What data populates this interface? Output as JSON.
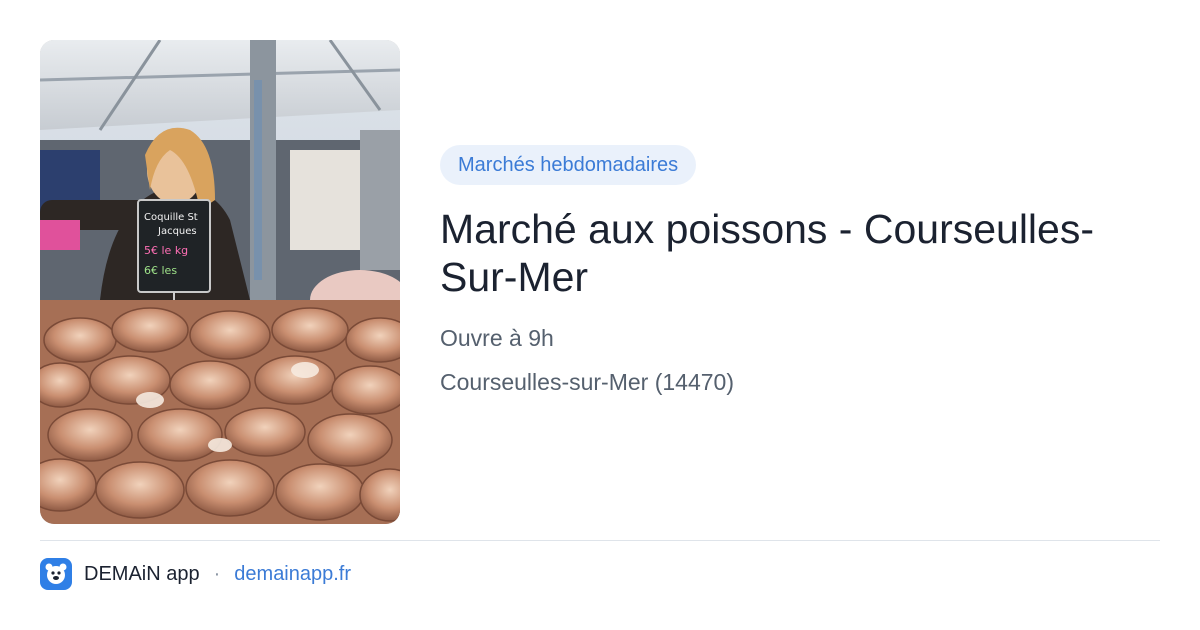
{
  "card": {
    "tag": "Marchés hebdomadaires",
    "title": "Marché aux poissons - Courseulles-Sur-Mer",
    "hours": "Ouvre à 9h",
    "location": "Courseulles-sur-Mer (14470)"
  },
  "photo_signs": {
    "sign_line1": "Coquille St",
    "sign_line2": "Jacques",
    "sign_price1": "5€ le kg",
    "sign_price2": "6€ les"
  },
  "footer": {
    "app_name": "DEMAiN app",
    "separator": "·",
    "domain": "demainapp.fr",
    "icon": "demain-app-logo-icon"
  },
  "colors": {
    "accent": "#3b7bd6",
    "tag_bg": "#eaf1fb",
    "title": "#1b2230",
    "meta": "#55606e",
    "logo_bg": "#2f7fe6"
  }
}
